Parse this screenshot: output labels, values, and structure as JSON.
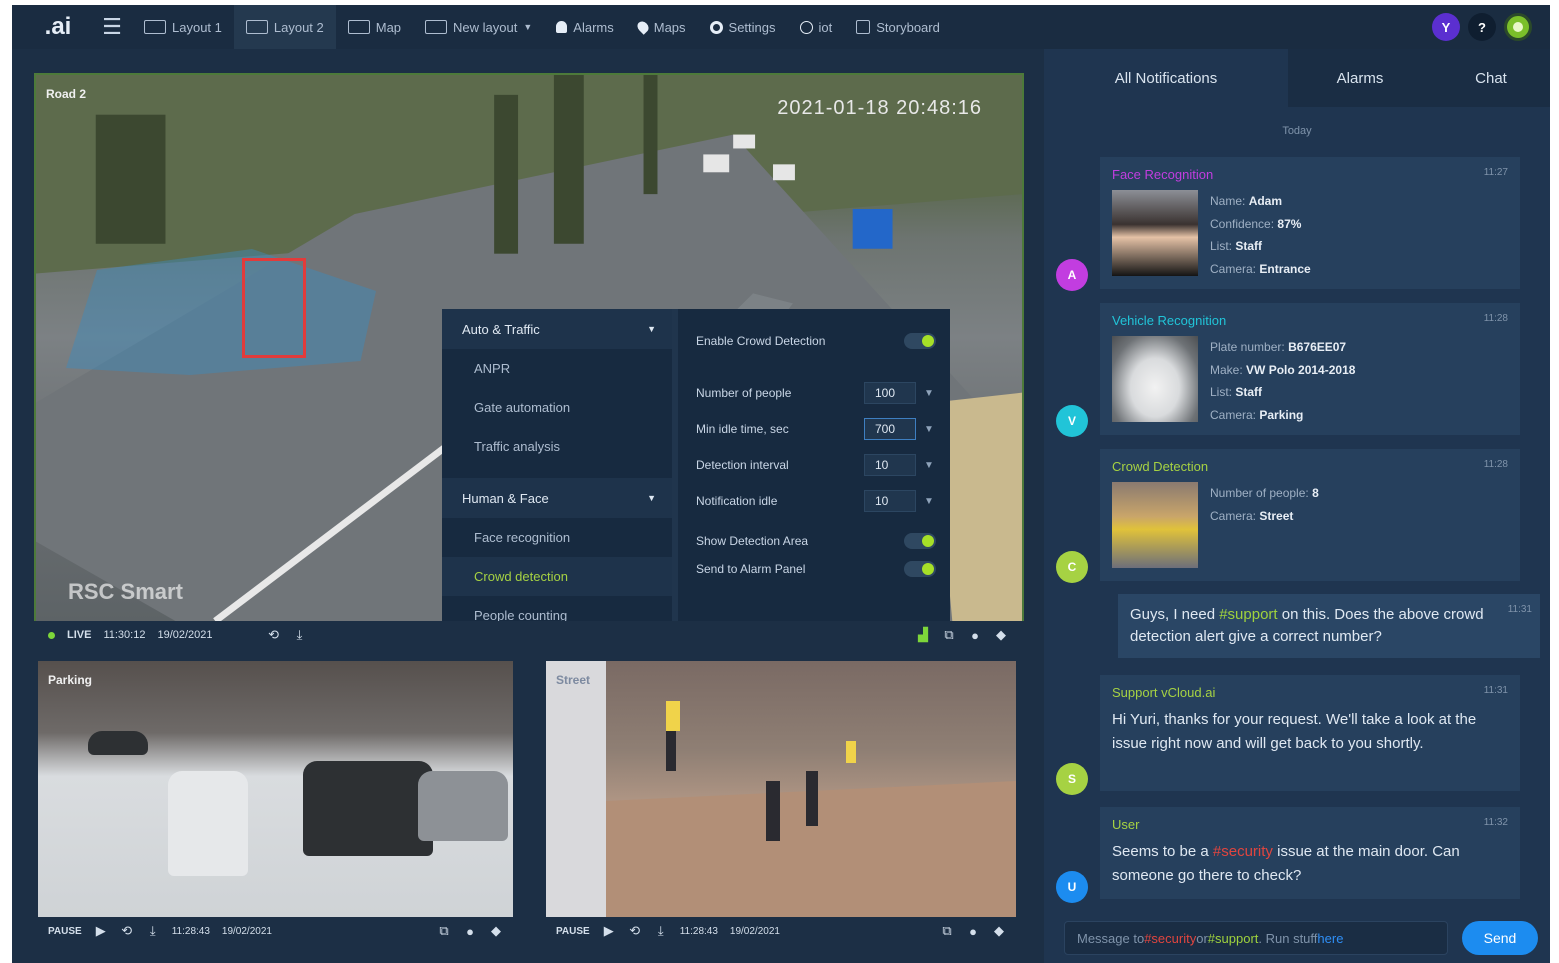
{
  "app": {
    "logo": ".ai"
  },
  "topbar": {
    "tabs": [
      {
        "label": "Layout 1",
        "icon": "grid-icon"
      },
      {
        "label": "Layout 2",
        "icon": "layout-icon",
        "active": true
      },
      {
        "label": "Map",
        "icon": "map-icon"
      },
      {
        "label": "New layout",
        "icon": "new-layout-icon"
      },
      {
        "label": "Alarms",
        "icon": "bell-icon"
      },
      {
        "label": "Maps",
        "icon": "pin-icon"
      },
      {
        "label": "Settings",
        "icon": "gear-icon"
      },
      {
        "label": "iot",
        "icon": "globe-icon"
      },
      {
        "label": "Storyboard",
        "icon": "storyboard-icon"
      }
    ],
    "avatar_letter": "Y",
    "help_label": "?"
  },
  "main_camera": {
    "name": "Road 2",
    "timestamp": "2021-01-18 20:48:16",
    "watermark": "RSC Smart",
    "status": "LIVE",
    "time": "11:30:12",
    "date": "19/02/2021"
  },
  "settings_panel": {
    "sections": [
      {
        "label": "Auto & Traffic",
        "items": [
          "ANPR",
          "Gate automation",
          "Traffic analysis"
        ]
      },
      {
        "label": "Human & Face",
        "items": [
          "Face recognition",
          "Crowd detection",
          "People counting"
        ]
      }
    ],
    "active_item": "Crowd detection",
    "enable_label": "Enable Crowd Detection",
    "fields": [
      {
        "label": "Number of people",
        "value": "100"
      },
      {
        "label": "Min idle time, sec",
        "value": "700"
      },
      {
        "label": "Detection interval",
        "value": "10"
      },
      {
        "label": "Notification idle",
        "value": "10"
      }
    ],
    "show_area_label": "Show Detection Area",
    "send_alarm_label": "Send to Alarm Panel"
  },
  "small_cameras": [
    {
      "name": "Parking",
      "status": "PAUSE",
      "time": "11:28:43",
      "date": "19/02/2021"
    },
    {
      "name": "Street",
      "status": "PAUSE",
      "time": "11:28:43",
      "date": "19/02/2021"
    }
  ],
  "panel": {
    "tabs": [
      "All Notifications",
      "Alarms",
      "Chat"
    ],
    "today": "Today",
    "face": {
      "title": "Face Recognition",
      "time": "11:27",
      "name_label": "Name:",
      "name": "Adam",
      "conf_label": "Confidence:",
      "conf": "87%",
      "list_label": "List:",
      "list": "Staff",
      "cam_label": "Camera:",
      "cam": "Entrance"
    },
    "vehicle": {
      "title": "Vehicle Recognition",
      "time": "11:28",
      "plate_label": "Plate number:",
      "plate": "B676EE07",
      "make_label": "Make:",
      "make": "VW Polo 2014-2018",
      "list_label": "List:",
      "list": "Staff",
      "cam_label": "Camera:",
      "cam": "Parking"
    },
    "crowd": {
      "title": "Crowd Detection",
      "time": "11:28",
      "num_label": "Number of people:",
      "num": "8",
      "cam_label": "Camera:",
      "cam": "Street"
    },
    "chat1": {
      "pre": "Guys, I need ",
      "tag": "#support",
      "post": " on this. Does the above crowd detection alert give a correct number?",
      "time": "11:31"
    },
    "support": {
      "title": "Support vCloud.ai",
      "time": "11:31",
      "text": "Hi Yuri, thanks for your request. We'll take a look at the issue right now and will get back to you shortly."
    },
    "user": {
      "title": "User",
      "time": "11:32",
      "pre": "Seems to be a ",
      "tag": "#security",
      "post": " issue at the main door. Can someone go there to check?"
    },
    "composer": {
      "pre": "Message to ",
      "t1": "#security",
      "mid": " or ",
      "t2": "#support",
      "post": ". Run stuff ",
      "t3": "here"
    },
    "send_label": "Send",
    "avatars": {
      "face": "A",
      "vehicle": "V",
      "crowd": "C",
      "support": "S",
      "user": "U"
    }
  },
  "colors": {
    "face": "#c23de0",
    "vehicle": "#21c4d8",
    "crowd": "#a6d243",
    "support": "#a6d243",
    "user": "#1c8cf0"
  }
}
